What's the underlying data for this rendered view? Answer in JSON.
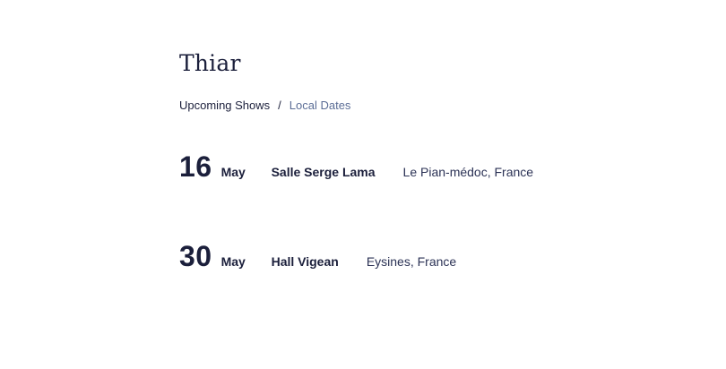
{
  "artist": {
    "name": "Thiar"
  },
  "breadcrumb": {
    "active": "Upcoming Shows",
    "separator": "/",
    "link": "Local Dates"
  },
  "shows": [
    {
      "day": "16",
      "month": "May",
      "venue": "Salle Serge Lama",
      "location": "Le Pian-médoc, France"
    },
    {
      "day": "30",
      "month": "May",
      "venue": "Hall Vigean",
      "location": "Eysines, France"
    }
  ],
  "colors": {
    "text_primary": "#1b1f3b",
    "text_link": "#5b6d96",
    "background": "#ffffff"
  }
}
